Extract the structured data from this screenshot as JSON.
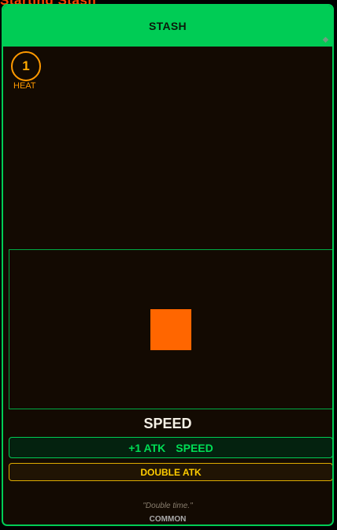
{
  "top_title": "Starting Stash",
  "card": {
    "header_title": "STASH",
    "corner_icon": "diamond-icon",
    "heat": {
      "value": "1",
      "label": "HEAT"
    },
    "art_icon": "orange-square",
    "name": "SPEED",
    "effects": [
      "+1 ATK",
      "SPEED"
    ],
    "trait": "DOUBLE ATK",
    "flavor": "\"Double time.\"",
    "rarity": "COMMON"
  },
  "colors": {
    "accent": "#00cc55",
    "background": "#130a02",
    "heat": "#ff9900",
    "art": "#ff6600",
    "trait": "#ffcc00",
    "title": "#ff4400"
  }
}
